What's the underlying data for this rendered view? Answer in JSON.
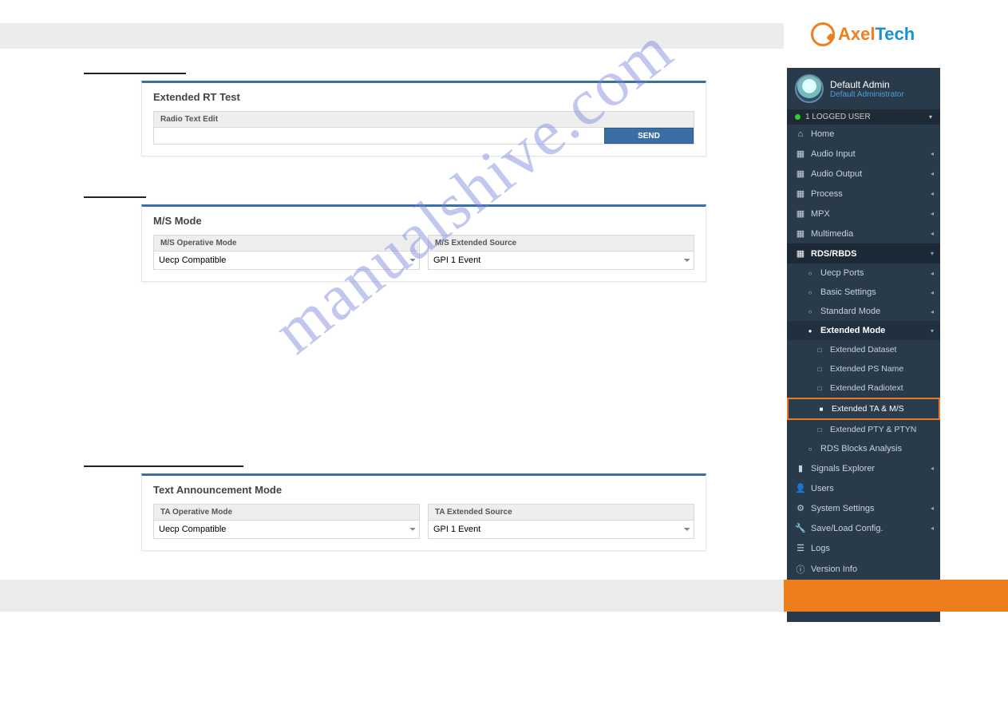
{
  "brand": {
    "part1": "Axel",
    "part2": "Tech"
  },
  "user": {
    "name": "Default Admin",
    "role": "Default Administrator"
  },
  "logged_bar": "1 LOGGED USER",
  "watermark": "manualshive.com",
  "panels": {
    "rt": {
      "title": "Extended RT Test",
      "field_label": "Radio Text Edit",
      "value": "",
      "send": "SEND"
    },
    "ms": {
      "title": "M/S Mode",
      "op_label": "M/S Operative Mode",
      "op_value": "Uecp Compatible",
      "src_label": "M/S Extended Source",
      "src_value": "GPI 1 Event"
    },
    "ta": {
      "title": "Text Announcement Mode",
      "op_label": "TA Operative Mode",
      "op_value": "Uecp Compatible",
      "src_label": "TA Extended Source",
      "src_value": "GPI 1 Event"
    }
  },
  "nav": {
    "home": "Home",
    "audio_input": "Audio Input",
    "audio_output": "Audio Output",
    "process": "Process",
    "mpx": "MPX",
    "multimedia": "Multimedia",
    "rds": "RDS/RBDS",
    "uecp": "Uecp Ports",
    "basic": "Basic Settings",
    "standard": "Standard Mode",
    "extended": "Extended Mode",
    "ext_dataset": "Extended Dataset",
    "ext_ps": "Extended PS Name",
    "ext_radiotext": "Extended Radiotext",
    "ext_ta_ms": "Extended TA & M/S",
    "ext_pty": "Extended PTY & PTYN",
    "blocks": "RDS Blocks Analysis",
    "signals": "Signals Explorer",
    "users": "Users",
    "system": "System Settings",
    "saveload": "Save/Load Config.",
    "logs": "Logs",
    "version": "Version Info"
  }
}
